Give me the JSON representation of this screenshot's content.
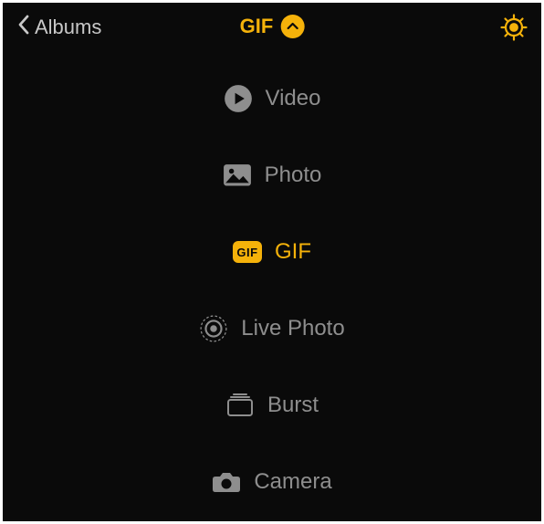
{
  "header": {
    "back_label": "Albums",
    "title": "GIF"
  },
  "menu": {
    "video": "Video",
    "photo": "Photo",
    "gif": "GIF",
    "gif_badge": "GIF",
    "live_photo": "Live Photo",
    "burst": "Burst",
    "camera": "Camera"
  },
  "colors": {
    "accent": "#f5b20a",
    "muted": "#8e8e8e"
  }
}
